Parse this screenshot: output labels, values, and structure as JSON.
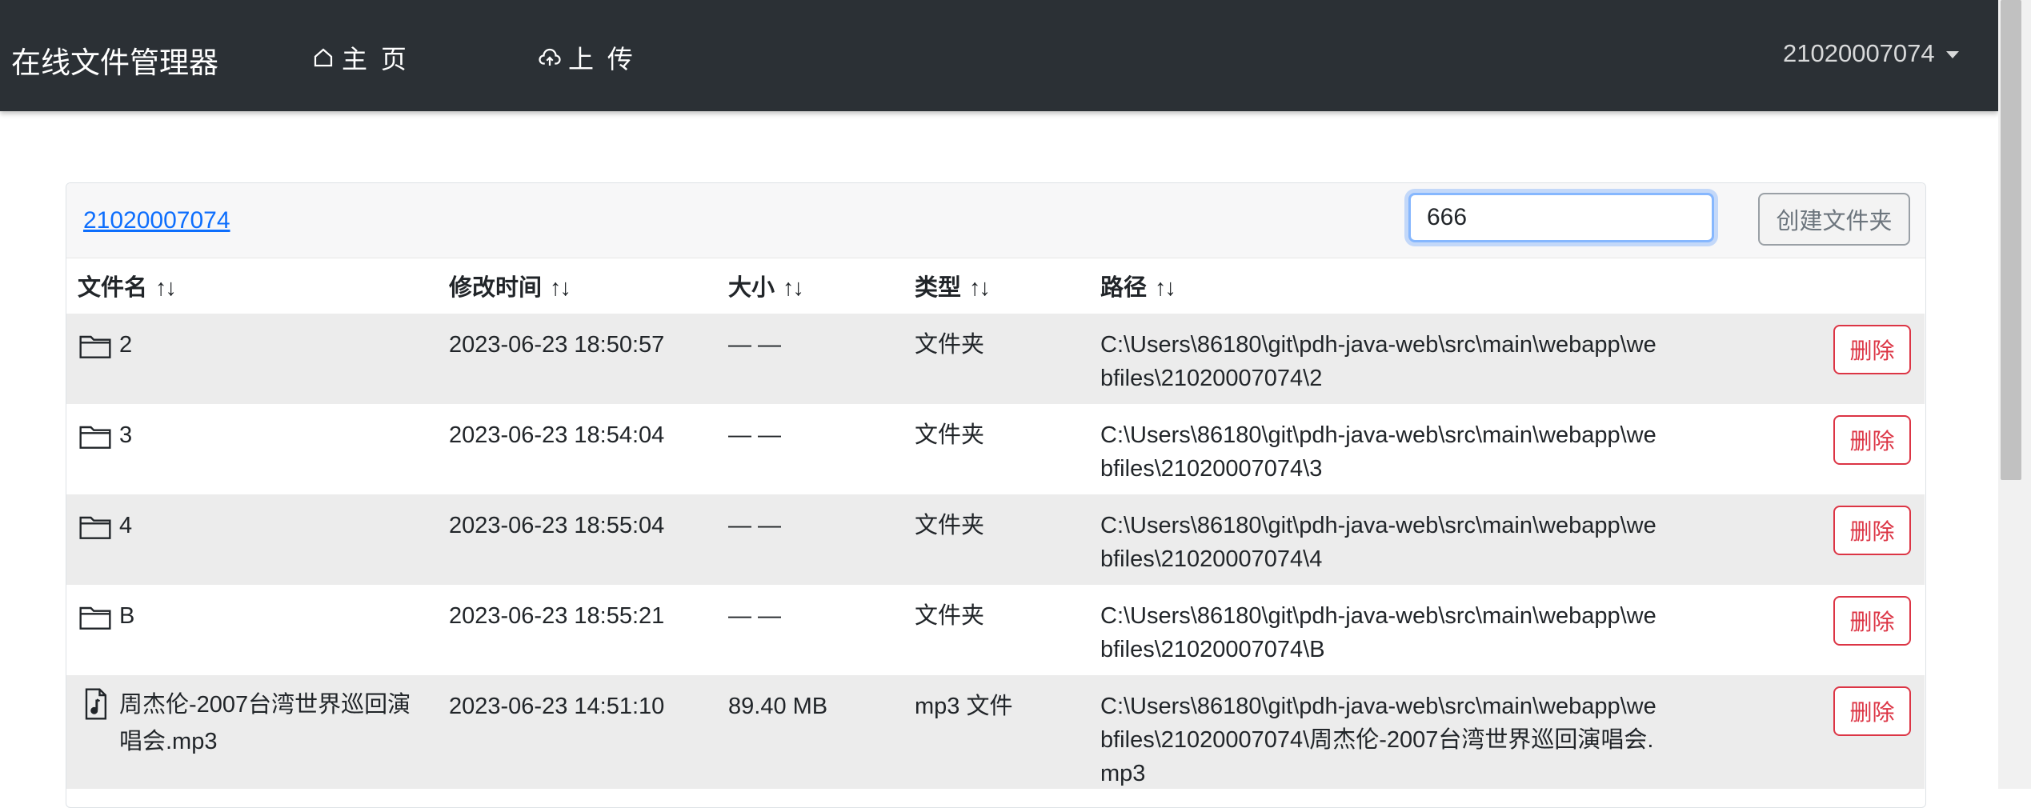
{
  "navbar": {
    "brand": "在线文件管理器",
    "home_label": "主 页",
    "upload_label": "上 传",
    "user": "21020007074"
  },
  "card": {
    "breadcrumb": "21020007074",
    "folder_input_value": "666",
    "create_button": "创建文件夹"
  },
  "table": {
    "headers": [
      {
        "label": "文件名",
        "sort": "↑↓"
      },
      {
        "label": "修改时间",
        "sort": "↑↓"
      },
      {
        "label": "大小",
        "sort": "↑↓"
      },
      {
        "label": "类型",
        "sort": "↑↓"
      },
      {
        "label": "路径",
        "sort": "↑↓"
      }
    ],
    "delete_label": "删除",
    "rows": [
      {
        "icon": "folder-icon",
        "name": "2",
        "time": "2023-06-23 18:50:57",
        "size": "— —",
        "type": "文件夹",
        "path": "C:\\Users\\86180\\git\\pdh-java-web\\src\\main\\webapp\\webfiles\\21020007074\\2"
      },
      {
        "icon": "folder-icon",
        "name": "3",
        "time": "2023-06-23 18:54:04",
        "size": "— —",
        "type": "文件夹",
        "path": "C:\\Users\\86180\\git\\pdh-java-web\\src\\main\\webapp\\webfiles\\21020007074\\3"
      },
      {
        "icon": "folder-icon",
        "name": "4",
        "time": "2023-06-23 18:55:04",
        "size": "— —",
        "type": "文件夹",
        "path": "C:\\Users\\86180\\git\\pdh-java-web\\src\\main\\webapp\\webfiles\\21020007074\\4"
      },
      {
        "icon": "folder-icon",
        "name": "B",
        "time": "2023-06-23 18:55:21",
        "size": "— —",
        "type": "文件夹",
        "path": "C:\\Users\\86180\\git\\pdh-java-web\\src\\main\\webapp\\webfiles\\21020007074\\B"
      },
      {
        "icon": "music-file-icon",
        "name": "周杰伦-2007台湾世界巡回演唱会.mp3",
        "time": "2023-06-23 14:51:10",
        "size": "89.40 MB",
        "type": "mp3 文件",
        "path": "C:\\Users\\86180\\git\\pdh-java-web\\src\\main\\webapp\\webfiles\\21020007074\\周杰伦-2007台湾世界巡回演唱会.mp3"
      }
    ]
  }
}
